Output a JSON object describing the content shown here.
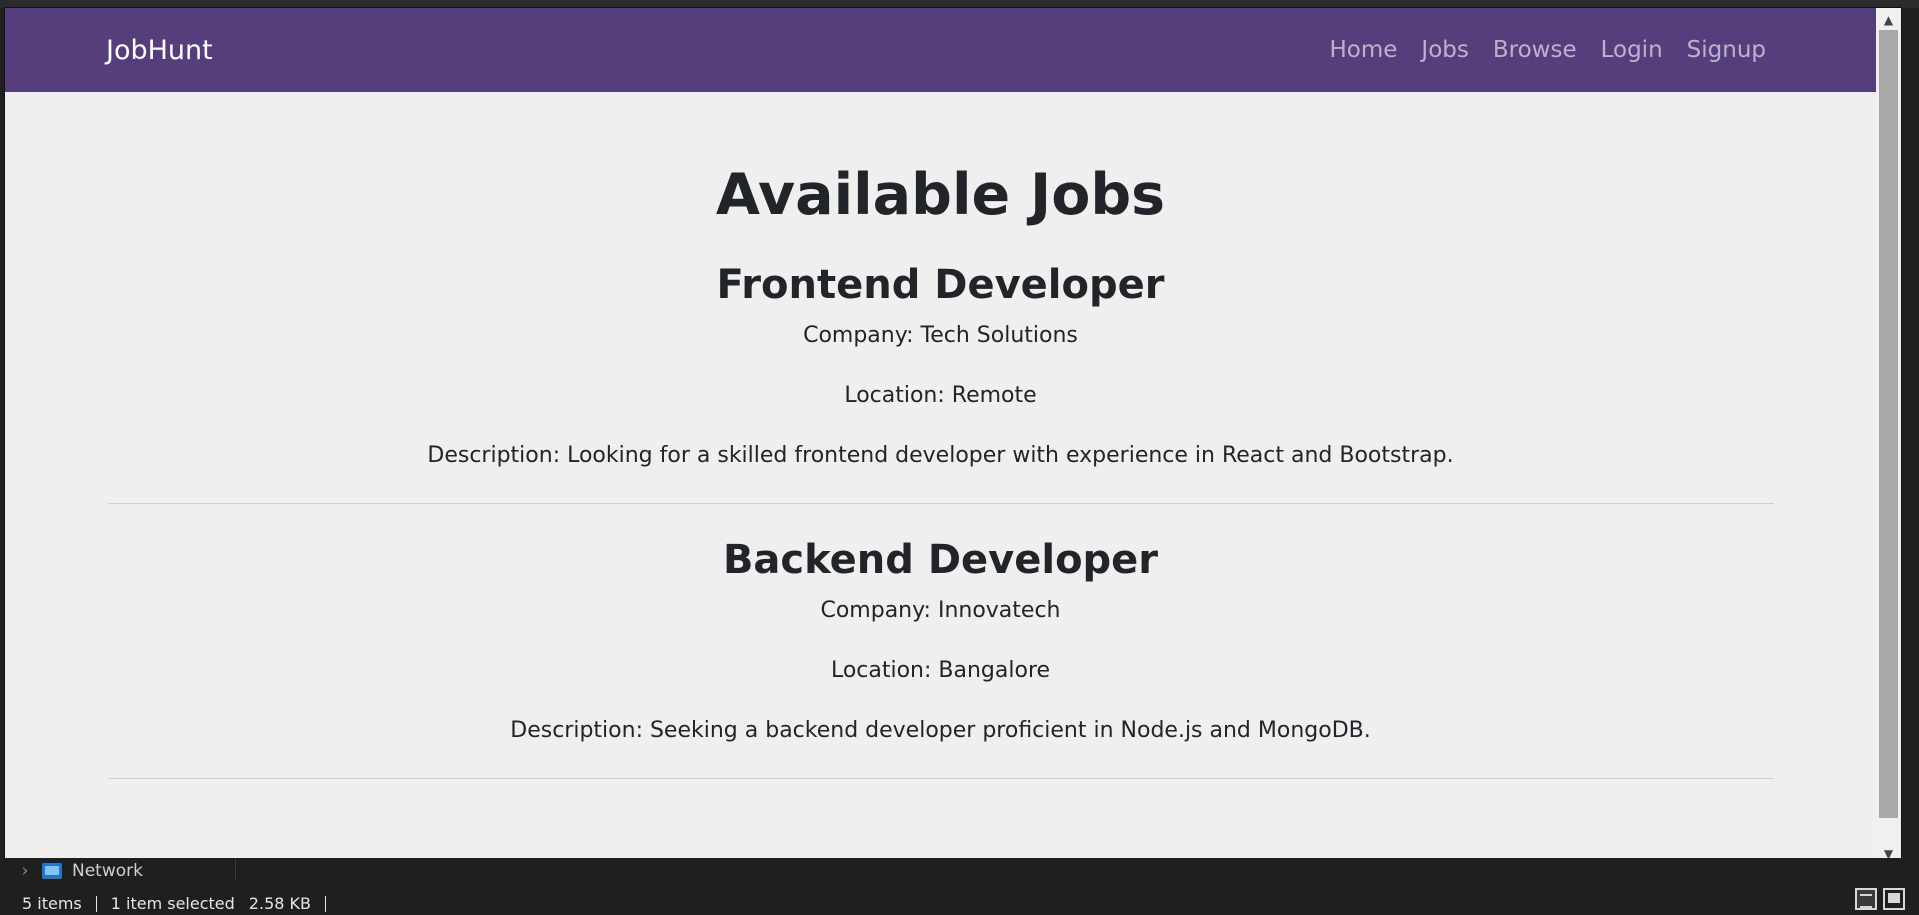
{
  "navbar": {
    "brand": "JobHunt",
    "links": [
      "Home",
      "Jobs",
      "Browse",
      "Login",
      "Signup"
    ]
  },
  "page": {
    "title": "Available Jobs"
  },
  "jobs": [
    {
      "title": "Frontend Developer",
      "company": "Company: Tech Solutions",
      "location": "Location: Remote",
      "description": "Description: Looking for a skilled frontend developer with experience in React and Bootstrap."
    },
    {
      "title": "Backend Developer",
      "company": "Company: Innovatech",
      "location": "Location: Bangalore",
      "description": "Description: Seeking a backend developer proficient in Node.js and MongoDB."
    }
  ],
  "explorer": {
    "nav_item": "Network",
    "status": {
      "items": "5 items",
      "selected": "1 item selected",
      "size": "2.58 KB"
    }
  },
  "colors": {
    "navbar_bg": "#563d7c",
    "page_bg": "#efefef"
  }
}
